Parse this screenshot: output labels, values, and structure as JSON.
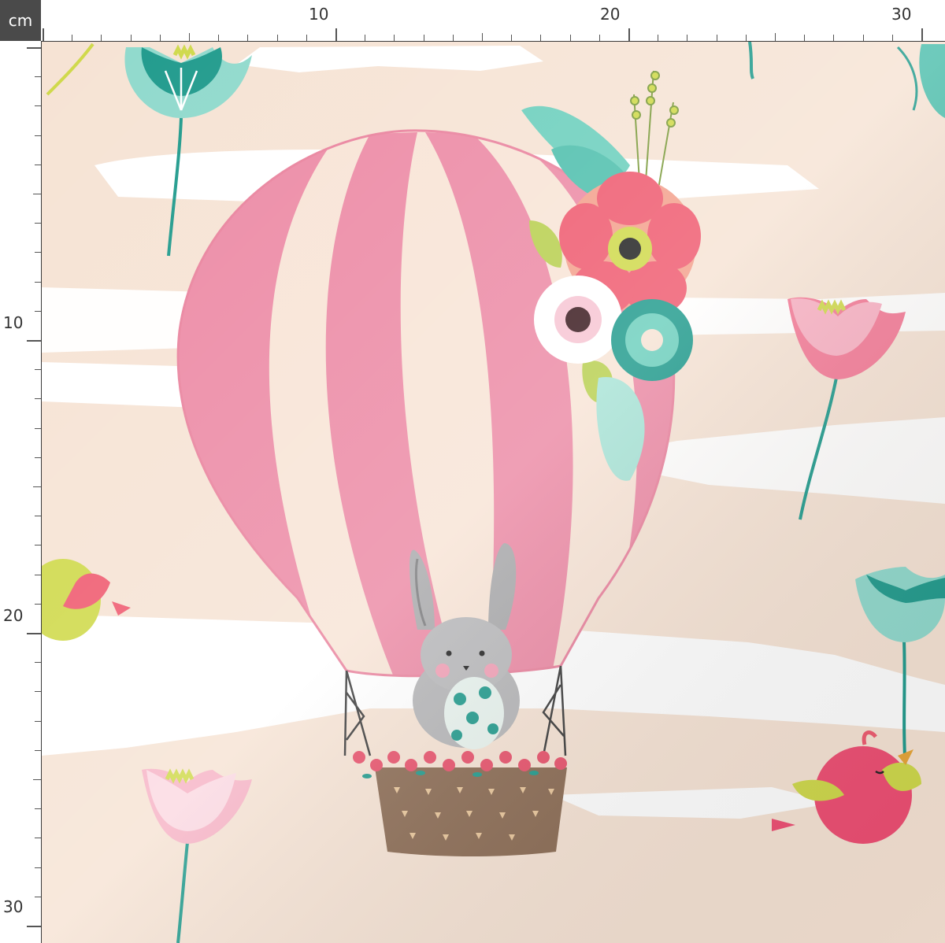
{
  "ruler": {
    "unit": "cm",
    "top_labels": [
      "10",
      "20",
      "30"
    ],
    "left_labels": [
      "10",
      "20",
      "30"
    ]
  },
  "fabric": {
    "background": "#f6e3d4",
    "balloon_pink": "#ec8aa5",
    "balloon_cream": "#f8e4d6",
    "basket": "#8a6a52",
    "bunny_gray": "#b5b5b7",
    "teal": "#1f9a8c",
    "mint": "#8fd9cc",
    "coral": "#ef6b7c",
    "lime": "#cfd94a"
  }
}
